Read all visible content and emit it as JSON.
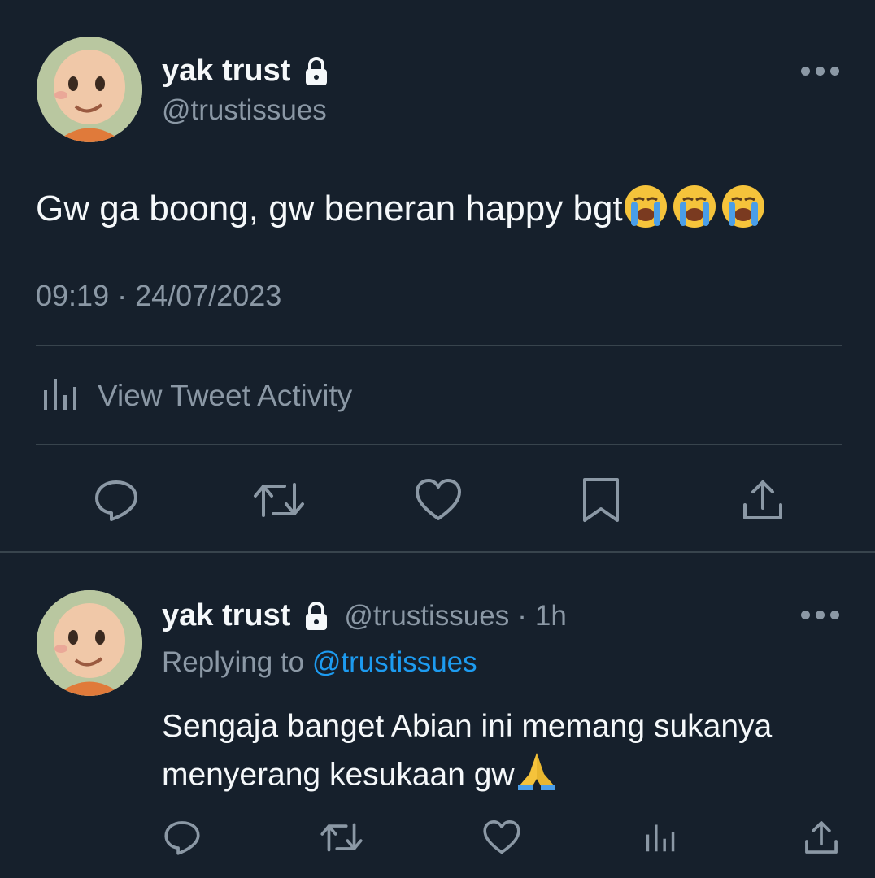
{
  "main_tweet": {
    "display_name": "yak trust",
    "handle": "@trustissues",
    "text": "Gw ga boong, gw beneran happy bgt",
    "emoji": "loudly-crying-face ×3",
    "timestamp": "09:19 · 24/07/2023",
    "activity_label": "View Tweet Activity",
    "icons": {
      "lock": "lock-icon",
      "more": "more-icon",
      "activity": "bar-chart-icon",
      "actions": [
        "reply-icon",
        "retweet-icon",
        "like-icon",
        "bookmark-icon",
        "share-icon"
      ]
    }
  },
  "reply_tweet": {
    "display_name": "yak trust",
    "handle": "@trustissues",
    "age": "1h",
    "separator": "·",
    "replying_prefix": "Replying to",
    "replying_to": "@trustissues",
    "text_line1": "Sengaja banget Abian ini memang sukanya",
    "text_line2": "menyerang kesukaan gw",
    "emoji": "folded-hands",
    "icons": {
      "actions": [
        "reply-icon",
        "retweet-icon",
        "like-icon",
        "views-icon",
        "share-icon"
      ]
    }
  },
  "colors": {
    "background": "#16202c",
    "text": "#f5f8fa",
    "muted": "#8b98a5",
    "link": "#1d9bf0",
    "divider": "#38444d"
  }
}
